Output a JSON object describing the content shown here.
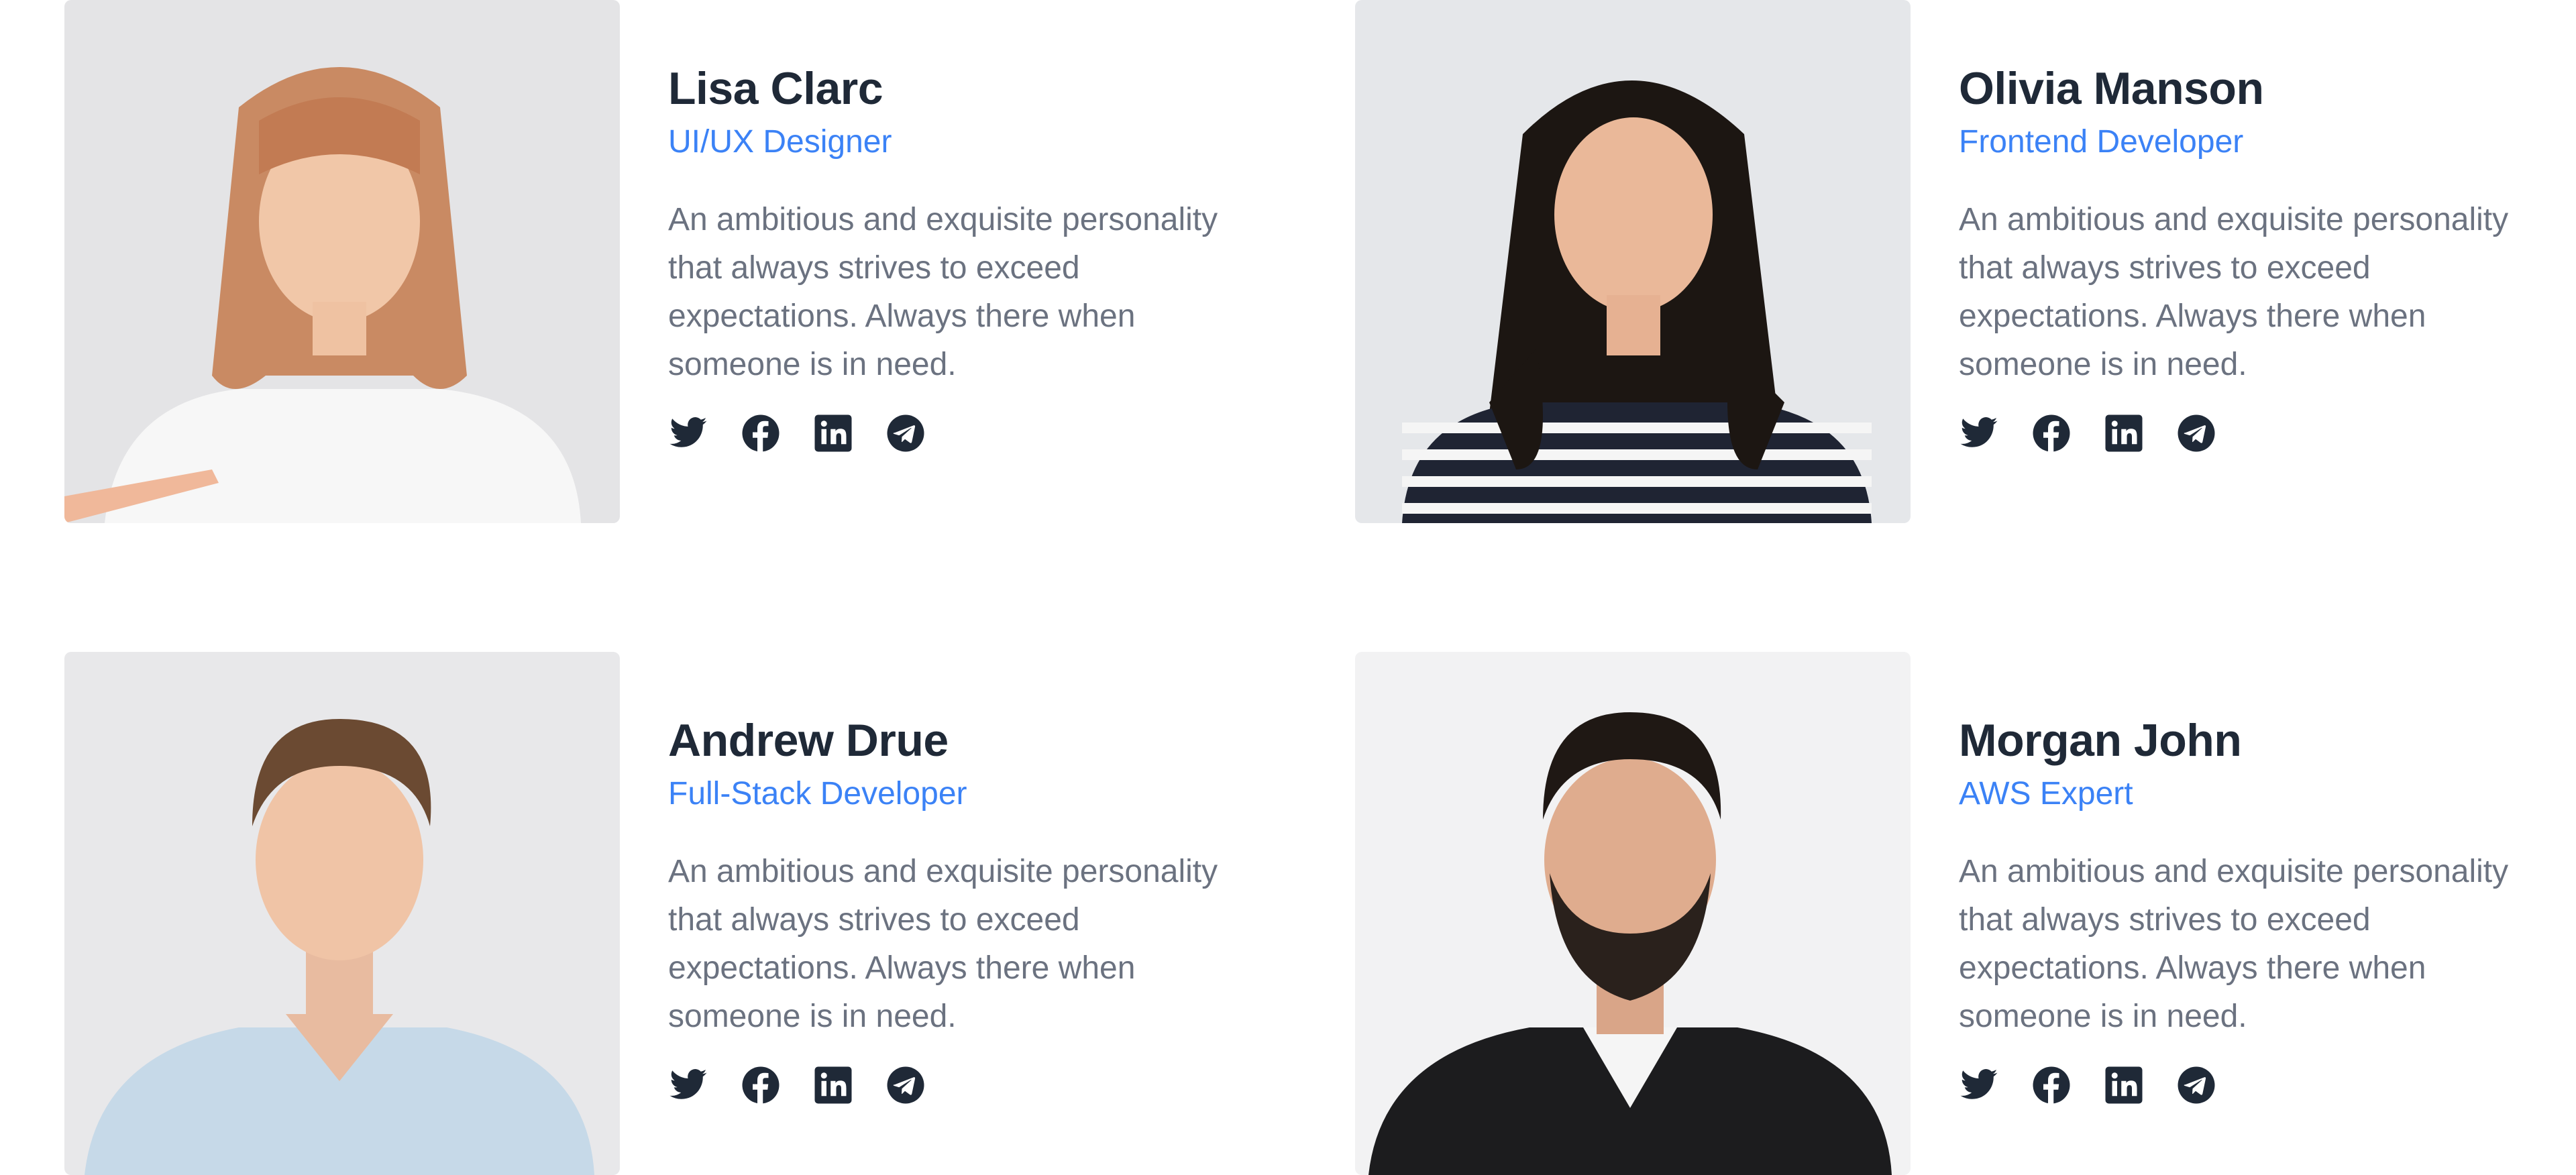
{
  "team": [
    {
      "name": "Lisa Clarc",
      "role": "UI/UX Designer",
      "bio": "An ambitious and exquisite personality that always strives to exceed expectations. Always there when someone is in need.",
      "photo_bg": "#e4e4e6"
    },
    {
      "name": "Olivia Manson",
      "role": "Frontend Developer",
      "bio": "An ambitious and exquisite personality that always strives to exceed expectations. Always there when someone is in need.",
      "photo_bg": "#e5e7ea"
    },
    {
      "name": "Andrew Drue",
      "role": "Full-Stack Developer",
      "bio": "An ambitious and exquisite personality that always strives to exceed expectations. Always there when someone is in need.",
      "photo_bg": "#e8e8ea"
    },
    {
      "name": "Morgan John",
      "role": "AWS Expert",
      "bio": "An ambitious and exquisite personality that always strives to exceed expectations. Always there when someone is in need.",
      "photo_bg": "#f2f2f3"
    }
  ],
  "social_icons": [
    "twitter-icon",
    "facebook-icon",
    "linkedin-icon",
    "telegram-icon"
  ],
  "colors": {
    "name": "#1f2937",
    "role": "#3b82f6",
    "bio": "#6b7280",
    "icon": "#1f2937"
  }
}
